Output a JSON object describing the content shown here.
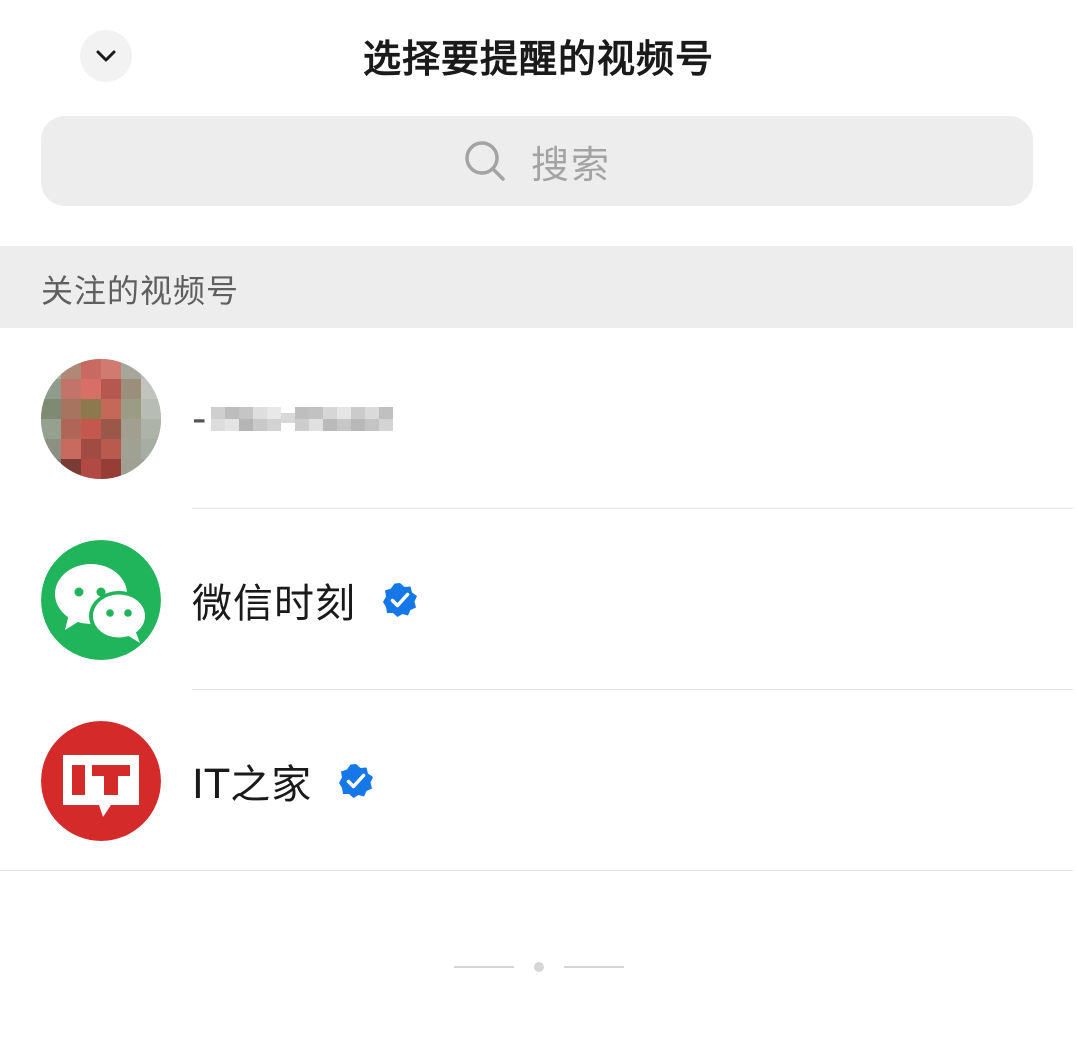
{
  "header": {
    "title": "选择要提醒的视频号",
    "collapse_icon": "chevron-down-icon"
  },
  "search": {
    "placeholder": "搜索",
    "icon": "search-icon"
  },
  "section": {
    "title": "关注的视频号"
  },
  "accounts": [
    {
      "name": "-",
      "name_obscured": true,
      "avatar": "blurred-photo-avatar",
      "verified": false
    },
    {
      "name": "微信时刻",
      "avatar": "wechat-logo-avatar",
      "verified": true
    },
    {
      "name": "IT之家",
      "avatar": "ithome-logo-avatar",
      "verified": true
    }
  ],
  "colors": {
    "wechat_green": "#1aad19",
    "ithome_red": "#d42a2a",
    "verified_blue": "#1677e8"
  },
  "pager": {
    "current_page": 1
  }
}
